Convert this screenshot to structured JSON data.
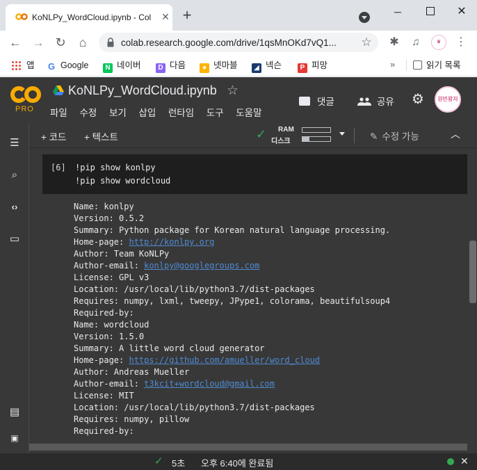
{
  "browser": {
    "tab_title": "KoNLPy_WordCloud.ipynb - Col",
    "tab_close": "✕",
    "new_tab": "+",
    "url": "colab.research.google.com/drive/1qsMnOKd7vQ1...",
    "minimize": "─",
    "close": "✕",
    "bookmarks": [
      {
        "label": "앱",
        "icon": "apps-grid-icon"
      },
      {
        "label": "Google",
        "icon": "google-icon",
        "color": "#4285f4",
        "glyph": "G"
      },
      {
        "label": "네이버",
        "icon": "naver-icon",
        "color": "#03c75a",
        "glyph": "N"
      },
      {
        "label": "다음",
        "icon": "daum-icon",
        "color": "#8a63f5",
        "glyph": "D"
      },
      {
        "label": "넷마블",
        "icon": "netmarble-icon",
        "color": "#ffb300",
        "glyph": "N"
      },
      {
        "label": "넥슨",
        "icon": "nexon-icon",
        "color": "#1a73e8",
        "glyph": "◢"
      },
      {
        "label": "피망",
        "icon": "pmang-icon",
        "color": "#e53935",
        "glyph": "P"
      }
    ],
    "overflow": "»",
    "reading_list": "읽기 목록"
  },
  "colab": {
    "logo_pro": "PRO",
    "notebook_title": "KoNLPy_WordCloud.ipynb",
    "menu": [
      "파일",
      "수정",
      "보기",
      "삽입",
      "런타임",
      "도구",
      "도움말"
    ],
    "comment_label": "댓글",
    "share_label": "공유",
    "add_code": "+ 코드",
    "add_text": "+ 텍스트",
    "ram_label": "RAM",
    "disk_label": "디스크",
    "ram_usage": 0,
    "disk_usage": 0.25,
    "edit_mode": "수정 가능",
    "avatar_text": "원빈왕자"
  },
  "cell": {
    "exec_count": "[6]",
    "code_lines": [
      "!pip show konlpy",
      "!pip show wordcloud"
    ]
  },
  "output": [
    {
      "text": "Name: konlpy"
    },
    {
      "text": "Version: 0.5.2"
    },
    {
      "text": "Summary: Python package for Korean natural language processing."
    },
    {
      "prefix": "Home-page: ",
      "link": "http://konlpy.org"
    },
    {
      "text": "Author: Team KoNLPy"
    },
    {
      "prefix": "Author-email: ",
      "link": "konlpy@googlegroups.com"
    },
    {
      "text": "License: GPL v3"
    },
    {
      "text": "Location: /usr/local/lib/python3.7/dist-packages"
    },
    {
      "text": "Requires: numpy, lxml, tweepy, JPype1, colorama, beautifulsoup4"
    },
    {
      "text": "Required-by:"
    },
    {
      "text": "Name: wordcloud"
    },
    {
      "text": "Version: 1.5.0"
    },
    {
      "text": "Summary: A little word cloud generator"
    },
    {
      "prefix": "Home-page: ",
      "link": "https://github.com/amueller/word_cloud"
    },
    {
      "text": "Author: Andreas Mueller"
    },
    {
      "prefix": "Author-email: ",
      "link": "t3kcit+wordcloud@gmail.com"
    },
    {
      "text": "License: MIT"
    },
    {
      "text": "Location: /usr/local/lib/python3.7/dist-packages"
    },
    {
      "text": "Requires: numpy, pillow"
    },
    {
      "text": "Required-by:"
    }
  ],
  "status": {
    "duration": "5초",
    "completed": "오후 6:40에 완료됨"
  },
  "colors": {
    "colab_bg": "#383838",
    "cell_bg": "#1e1e1e",
    "link": "#4f8bd3",
    "success": "#34a853",
    "colab_orange": "#f9ab00"
  }
}
